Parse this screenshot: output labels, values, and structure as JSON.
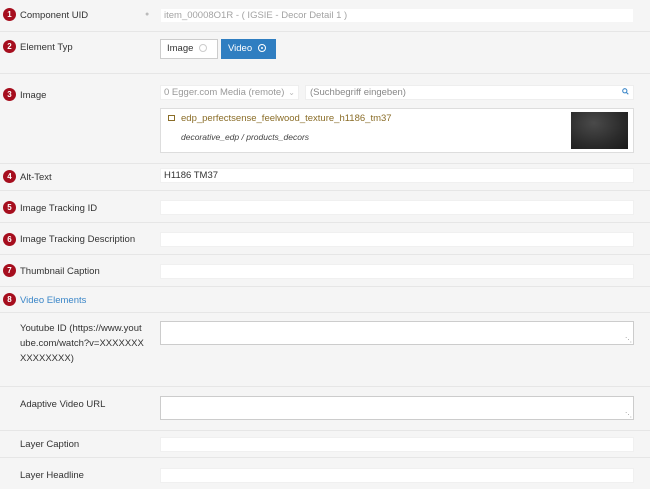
{
  "fields": {
    "component_uid": {
      "num": "1",
      "label": "Component UID",
      "value": "item_00008O1R - ( IGSIE - Decor Detail 1 )"
    },
    "element_type": {
      "num": "2",
      "label": "Element Typ",
      "options": [
        "Image",
        "Video"
      ],
      "selected": "Video"
    },
    "image": {
      "num": "3",
      "label": "Image",
      "source": "0 Egger.com Media (remote)",
      "search_placeholder": "(Suchbegriff eingeben)",
      "asset_name": "edp_perfectsense_feelwood_texture_h1186_tm37",
      "asset_path": "decorative_edp / products_decors"
    },
    "alt_text": {
      "num": "4",
      "label": "Alt-Text",
      "value": "H1186 TM37"
    },
    "tracking_id": {
      "num": "5",
      "label": "Image Tracking ID",
      "value": ""
    },
    "tracking_desc": {
      "num": "6",
      "label": "Image Tracking Description",
      "value": ""
    },
    "thumb_caption": {
      "num": "7",
      "label": "Thumbnail Caption",
      "value": ""
    },
    "video_elements": {
      "num": "8",
      "label": "Video Elements"
    },
    "youtube_id": {
      "label": "Youtube ID (https://www.youtube.com/watch?v=XXXXXXXXXXXXXXX)"
    },
    "adaptive_video": {
      "label": "Adaptive Video URL"
    },
    "layer_caption": {
      "label": "Layer Caption"
    },
    "layer_headline": {
      "label": "Layer Headline"
    }
  },
  "colors": {
    "badge": "#a60e1e",
    "accent": "#2f7ec1",
    "link": "#3a86c8",
    "asset_text": "#8a6d28"
  }
}
